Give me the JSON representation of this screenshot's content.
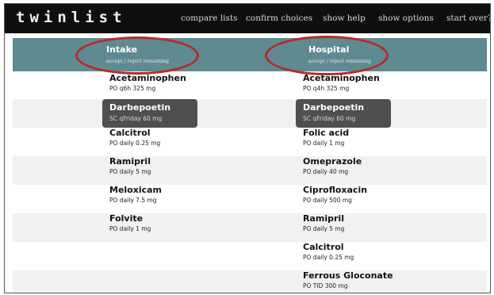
{
  "app": {
    "logo": "twinlist"
  },
  "nav": [
    "compare lists",
    "confirm choices",
    "show help",
    "show options",
    "start over?"
  ],
  "columns": [
    {
      "title": "Intake",
      "subtitle": "accept / reject remaining"
    },
    {
      "title": "Hospital",
      "subtitle": "accept / reject remaining"
    }
  ],
  "intake": [
    {
      "name": "Acetaminophen",
      "detail": "PO  q6h  325 mg"
    },
    {
      "name": "Darbepoetin",
      "detail": "SC  qFriday  60 mg"
    },
    {
      "name": "Calcitrol",
      "detail": "PO  daily  0.25 mg"
    },
    {
      "name": "Ramipril",
      "detail": "PO  daily  5 mg"
    },
    {
      "name": "Meloxicam",
      "detail": "PO  daily  7.5 mg"
    },
    {
      "name": "Folvite",
      "detail": "PO  daily  1 mg"
    }
  ],
  "hospital": [
    {
      "name": "Acetaminophen",
      "detail": "PO  q4h  325 mg"
    },
    {
      "name": "Darbepoetin",
      "detail": "SC  qFriday  60 mg"
    },
    {
      "name": "Folic acid",
      "detail": "PO  daily  1 mg"
    },
    {
      "name": "Omeprazole",
      "detail": "PO  daily  40 mg"
    },
    {
      "name": "Ciprofloxacin",
      "detail": "PO  daily  500 mg"
    },
    {
      "name": "Ramipril",
      "detail": "PO  daily  5 mg"
    },
    {
      "name": "Calcitrol",
      "detail": "PO  daily  0.25 mg"
    },
    {
      "name": "Ferrous Gloconate",
      "detail": "PO  TID  300 mg"
    }
  ],
  "selected_name": "Darbepoetin",
  "colors": {
    "topbar": "#0f0f0f",
    "header": "#5f8a92",
    "selected": "#4f4f4f",
    "annotation": "#b42a2a",
    "alt_row": "#f1f1f1"
  }
}
